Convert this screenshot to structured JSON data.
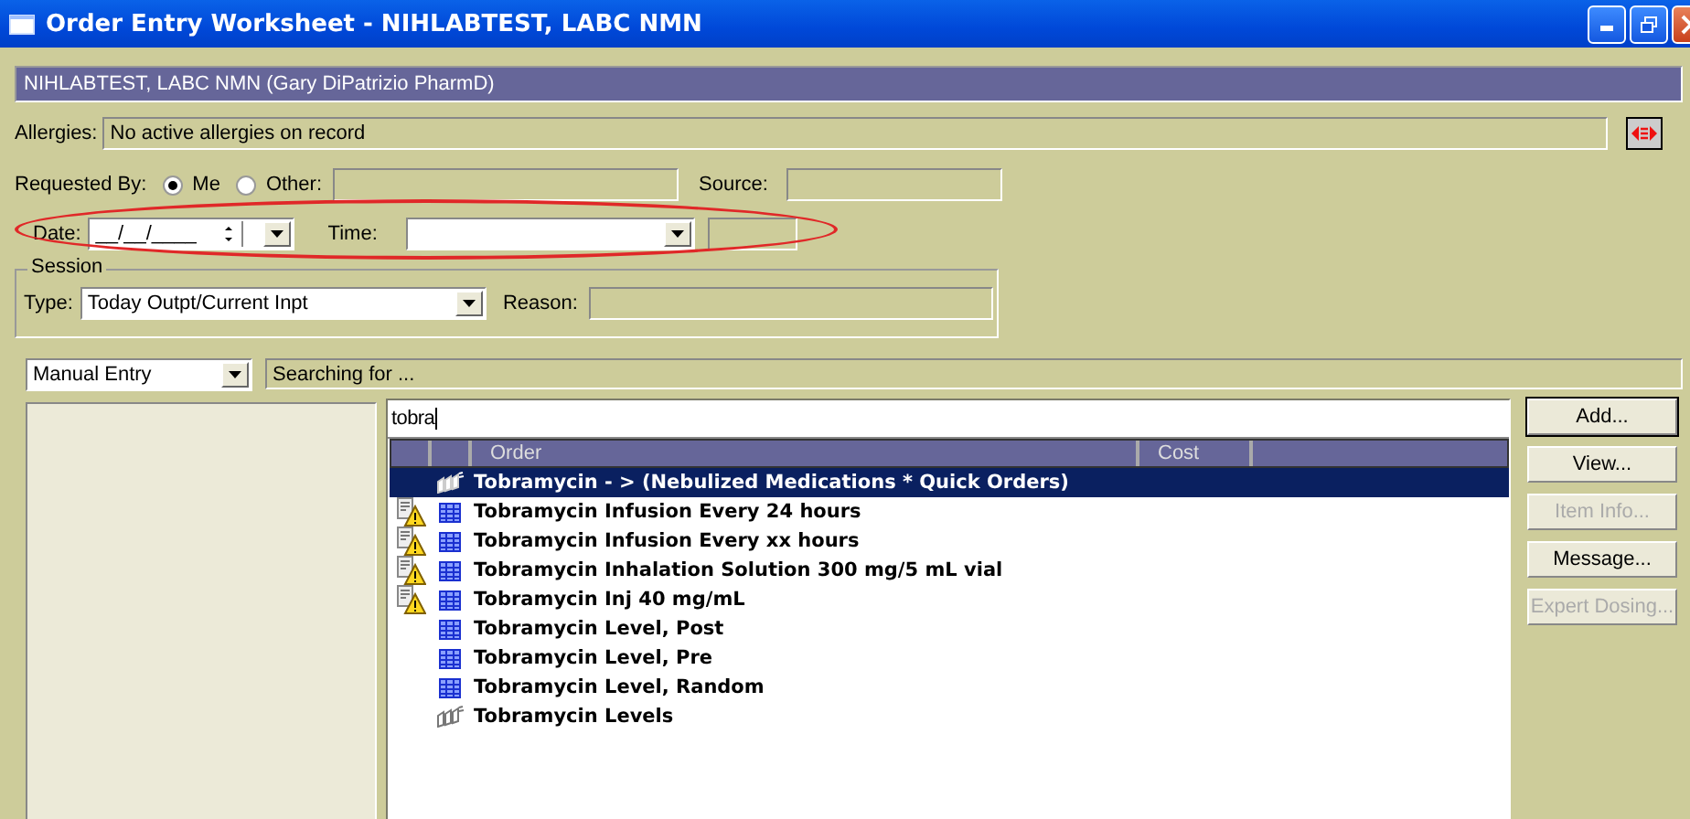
{
  "window": {
    "title": "Order Entry Worksheet - NIHLABTEST, LABC NMN"
  },
  "patient_banner": "NIHLABTEST, LABC NMN (Gary DiPatrizio PharmD)",
  "allergies": {
    "label": "Allergies:",
    "value": "No active allergies on record"
  },
  "requested_by": {
    "label": "Requested By:",
    "options": [
      {
        "label": "Me",
        "selected": true
      },
      {
        "label": "Other:",
        "selected": false
      }
    ],
    "source_label": "Source:"
  },
  "date": {
    "label": "Date:",
    "value": "__/__/____"
  },
  "time": {
    "label": "Time:"
  },
  "highlight": {
    "kind": "ellipse"
  },
  "session": {
    "title": "Session",
    "type_label": "Type:",
    "type_value": "Today Outpt/Current Inpt",
    "reason_label": "Reason:"
  },
  "entry_mode": "Manual Entry",
  "status": "Searching for ...",
  "search": {
    "value": "tobra"
  },
  "orders": {
    "columns": [
      "Order",
      "Cost"
    ],
    "rows": [
      {
        "text": "Tobramycin - > (Nebulized Medications * Quick Orders)",
        "kind": "group",
        "warning": false,
        "selected": true
      },
      {
        "text": "Tobramycin Infusion Every 24 hours",
        "kind": "item",
        "warning": true,
        "selected": false
      },
      {
        "text": "Tobramycin Infusion Every xx hours",
        "kind": "item",
        "warning": true,
        "selected": false
      },
      {
        "text": "Tobramycin Inhalation Solution 300 mg/5 mL vial",
        "kind": "item",
        "warning": true,
        "selected": false
      },
      {
        "text": "Tobramycin Inj 40 mg/mL",
        "kind": "item",
        "warning": true,
        "selected": false
      },
      {
        "text": "Tobramycin Level, Post",
        "kind": "item",
        "warning": false,
        "selected": false
      },
      {
        "text": "Tobramycin Level, Pre",
        "kind": "item",
        "warning": false,
        "selected": false
      },
      {
        "text": "Tobramycin Level, Random",
        "kind": "item",
        "warning": false,
        "selected": false
      },
      {
        "text": "Tobramycin Levels",
        "kind": "group",
        "warning": false,
        "selected": false
      }
    ]
  },
  "buttons": [
    {
      "label": "Add...",
      "disabled": false,
      "default": true
    },
    {
      "label": "View...",
      "disabled": false,
      "default": false
    },
    {
      "label": "Item Info...",
      "disabled": true,
      "default": false
    },
    {
      "label": "Message...",
      "disabled": false,
      "default": false
    },
    {
      "label": "Expert Dosing...",
      "disabled": true,
      "default": false
    }
  ]
}
